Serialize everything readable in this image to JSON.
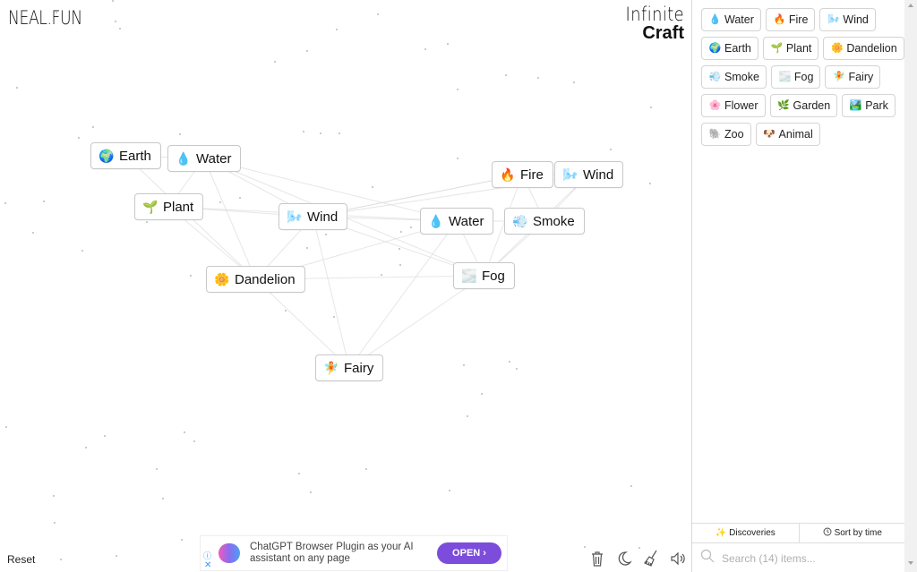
{
  "header": {
    "logo": "NEAL.FUN",
    "brand_line1": "Infinite",
    "brand_line2": "Craft"
  },
  "canvas": {
    "nodes": [
      {
        "label": "Earth",
        "icon": "globe-icon",
        "emoji": "🌍"
      },
      {
        "label": "Water",
        "icon": "water-drop-icon",
        "emoji": "💧"
      },
      {
        "label": "Plant",
        "icon": "seedling-icon",
        "emoji": "🌱"
      },
      {
        "label": "Wind",
        "icon": "wind-icon",
        "emoji": "🌬️"
      },
      {
        "label": "Dandelion",
        "icon": "flower-icon",
        "emoji": "🌼"
      },
      {
        "label": "Fire",
        "icon": "fire-icon",
        "emoji": "🔥"
      },
      {
        "label": "Wind",
        "icon": "wind-icon",
        "emoji": "🌬️"
      },
      {
        "label": "Water",
        "icon": "water-drop-icon",
        "emoji": "💧"
      },
      {
        "label": "Smoke",
        "icon": "smoke-icon",
        "emoji": "💨"
      },
      {
        "label": "Fog",
        "icon": "fog-icon",
        "emoji": "🌫️"
      },
      {
        "label": "Fairy",
        "icon": "fairy-icon",
        "emoji": "🧚"
      }
    ],
    "reset_label": "Reset"
  },
  "ad": {
    "text": "ChatGPT Browser Plugin as your AI assistant on any page",
    "button": "OPEN ›",
    "info": "ⓘ",
    "close": "✕"
  },
  "toolbar": {
    "tools": [
      {
        "name": "trash-icon"
      },
      {
        "name": "dark-mode-icon"
      },
      {
        "name": "clean-broom-icon"
      },
      {
        "name": "sound-icon"
      }
    ]
  },
  "sidebar": {
    "items": [
      {
        "label": "Water",
        "emoji": "💧",
        "icon": "water-drop-icon"
      },
      {
        "label": "Fire",
        "emoji": "🔥",
        "icon": "fire-icon"
      },
      {
        "label": "Wind",
        "emoji": "🌬️",
        "icon": "wind-icon"
      },
      {
        "label": "Earth",
        "emoji": "🌍",
        "icon": "globe-icon"
      },
      {
        "label": "Plant",
        "emoji": "🌱",
        "icon": "seedling-icon"
      },
      {
        "label": "Dandelion",
        "emoji": "🌼",
        "icon": "flower-icon"
      },
      {
        "label": "Smoke",
        "emoji": "💨",
        "icon": "smoke-icon"
      },
      {
        "label": "Fog",
        "emoji": "🌫️",
        "icon": "fog-icon"
      },
      {
        "label": "Fairy",
        "emoji": "🧚",
        "icon": "fairy-icon"
      },
      {
        "label": "Flower",
        "emoji": "🌸",
        "icon": "blossom-icon"
      },
      {
        "label": "Garden",
        "emoji": "🌿",
        "icon": "leaf-icon"
      },
      {
        "label": "Park",
        "emoji": "🏞️",
        "icon": "park-icon"
      },
      {
        "label": "Zoo",
        "emoji": "🐘",
        "icon": "elephant-icon"
      },
      {
        "label": "Animal",
        "emoji": "🐶",
        "icon": "animal-icon"
      }
    ],
    "discoveries_label": "Discoveries",
    "sort_label": "Sort by time",
    "search_placeholder": "Search (14) items..."
  },
  "colors": {
    "ad_button": "#7c4ddb",
    "border": "#c8c8c8"
  }
}
